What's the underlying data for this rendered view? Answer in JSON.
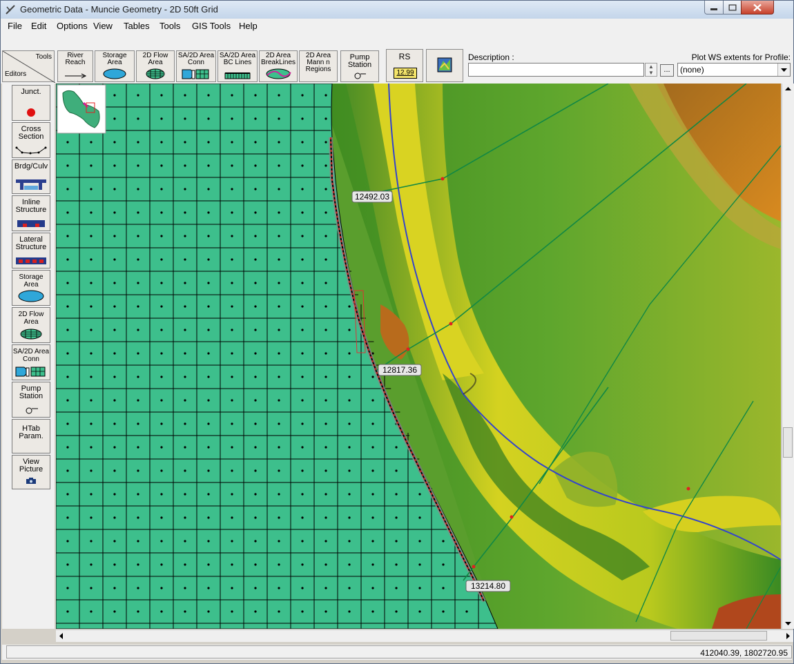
{
  "window": {
    "title": "Geometric Data - Muncie Geometry - 2D 50ft Grid"
  },
  "menu": [
    "File",
    "Edit",
    "Options",
    "View",
    "Tables",
    "Tools",
    "GIS Tools",
    "Help"
  ],
  "toolbar": {
    "tools_label": "Tools",
    "editors_label": "Editors",
    "buttons": [
      {
        "l1": "River",
        "l2": "Reach"
      },
      {
        "l1": "Storage",
        "l2": "Area"
      },
      {
        "l1": "2D Flow",
        "l2": "Area"
      },
      {
        "l1": "SA/2D Area",
        "l2": "Conn"
      },
      {
        "l1": "SA/2D Area",
        "l2": "BC Lines"
      },
      {
        "l1": "2D Area",
        "l2": "BreakLines"
      },
      {
        "l1": "2D Area",
        "l2": "Mann n",
        "l3": "Regions"
      },
      {
        "l1": "Pump",
        "l2": "Station"
      }
    ],
    "rs_label": "RS",
    "rs_value": "12.99",
    "description_label": "Description :",
    "description_value": "",
    "ellipsis_label": "...",
    "profile_label": "Plot WS extents for Profile:",
    "profile_value": "(none)"
  },
  "editors": [
    {
      "l1": "Junct.",
      "l2": ""
    },
    {
      "l1": "Cross",
      "l2": "Section"
    },
    {
      "l1": "Brdg/Culv",
      "l2": ""
    },
    {
      "l1": "Inline",
      "l2": "Structure"
    },
    {
      "l1": "Lateral",
      "l2": "Structure"
    },
    {
      "l1": "Storage",
      "l2": "Area"
    },
    {
      "l1": "2D Flow",
      "l2": "Area"
    },
    {
      "l1": "SA/2D Area",
      "l2": "Conn"
    },
    {
      "l1": "Pump",
      "l2": "Station"
    },
    {
      "l1": "HTab",
      "l2": "Param."
    },
    {
      "l1": "View",
      "l2": "Picture"
    }
  ],
  "map": {
    "cross_sections": [
      "12492.03",
      "12817.36",
      "13214.80"
    ]
  },
  "status": {
    "coordinates": "412040.39, 1802720.95"
  },
  "colors": {
    "grid_fill": "#3dbf8c",
    "river_line": "#3344cc",
    "xs_line": "#118844",
    "breakline": "#cc2222"
  }
}
